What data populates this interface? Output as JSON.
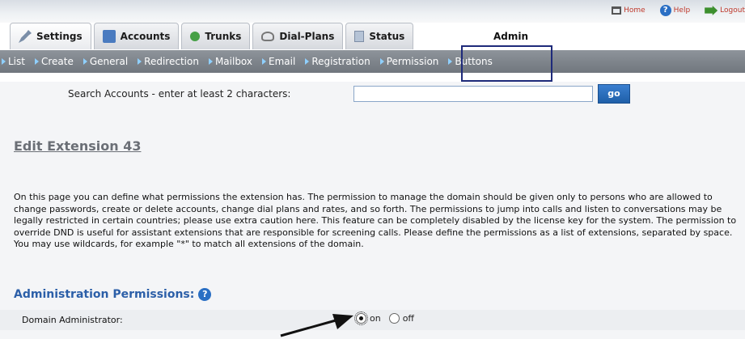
{
  "top_links": {
    "home": "Home",
    "help": "Help",
    "logout": "Logout"
  },
  "tabs": [
    {
      "label": "Settings",
      "icon": "settings-icon"
    },
    {
      "label": "Accounts",
      "icon": "accounts-icon"
    },
    {
      "label": "Trunks",
      "icon": "trunks-icon"
    },
    {
      "label": "Dial-Plans",
      "icon": "dialplans-icon"
    },
    {
      "label": "Status",
      "icon": "status-icon"
    }
  ],
  "admin_label": "Admin",
  "subnav": [
    "List",
    "Create",
    "General",
    "Redirection",
    "Mailbox",
    "Email",
    "Registration",
    "Permission",
    "Buttons"
  ],
  "search": {
    "label": "Search Accounts - enter at least 2 characters:",
    "value": "",
    "button": "go"
  },
  "page_title": "Edit Extension 43",
  "description": "On this page you can define what permissions the extension has. The permission to manage the domain should be given only to persons who are allowed to change passwords, create or delete accounts, change dial plans and rates, and so forth. The permissions to jump into calls and listen to conversations may be legally restricted in certain countries; please use extra caution here. This feature can be completely disabled by the license key for the system. The permission to override DND is useful for assistant extensions that are responsible for screening calls. Please define the permissions as a list of extensions, separated by space. You may use wildcards, for example \"*\" to match all extensions of the domain.",
  "section": {
    "title": "Administration Permissions:",
    "help_icon": "?"
  },
  "domain_admin": {
    "label": "Domain Administrator:",
    "on_label": "on",
    "off_label": "off",
    "selected": "on"
  },
  "colors": {
    "accent": "#2c5fa8",
    "highlight_box": "#1e2a7a",
    "subnav_bg": "#7d838a"
  }
}
